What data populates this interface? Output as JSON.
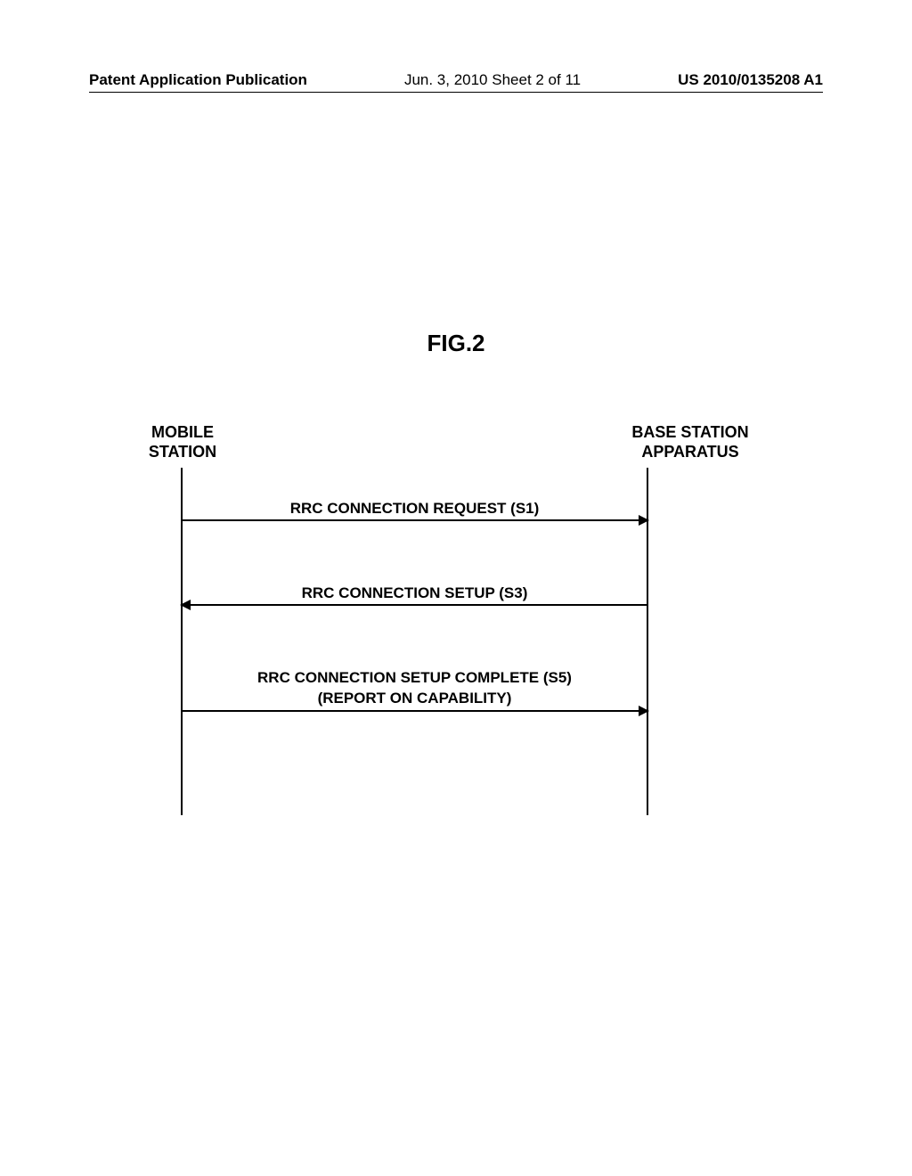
{
  "header": {
    "left": "Patent Application Publication",
    "center": "Jun. 3, 2010  Sheet 2 of 11",
    "right": "US 2010/0135208 A1"
  },
  "figure": {
    "title": "FIG.2",
    "left_entity_line1": "MOBILE",
    "left_entity_line2": "STATION",
    "right_entity_line1": "BASE STATION",
    "right_entity_line2": "APPARATUS",
    "messages": {
      "m1": "RRC CONNECTION REQUEST (S1)",
      "m2": "RRC CONNECTION SETUP (S3)",
      "m3_line1": "RRC CONNECTION SETUP COMPLETE (S5)",
      "m3_line2": "(REPORT ON CAPABILITY)"
    }
  },
  "chart_data": {
    "type": "table",
    "description": "Sequence diagram: RRC connection setup message flow between Mobile Station and Base Station Apparatus",
    "entities": [
      "MOBILE STATION",
      "BASE STATION APPARATUS"
    ],
    "messages": [
      {
        "step": "S1",
        "from": "MOBILE STATION",
        "to": "BASE STATION APPARATUS",
        "label": "RRC CONNECTION REQUEST"
      },
      {
        "step": "S3",
        "from": "BASE STATION APPARATUS",
        "to": "MOBILE STATION",
        "label": "RRC CONNECTION SETUP"
      },
      {
        "step": "S5",
        "from": "MOBILE STATION",
        "to": "BASE STATION APPARATUS",
        "label": "RRC CONNECTION SETUP COMPLETE (REPORT ON CAPABILITY)"
      }
    ]
  }
}
